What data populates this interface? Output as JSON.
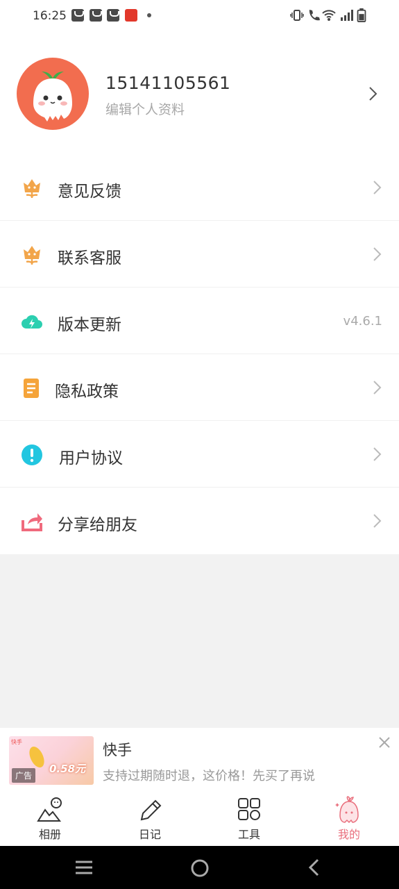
{
  "status_bar": {
    "time": "16:25"
  },
  "profile": {
    "phone": "15141105561",
    "subtitle": "编辑个人资料"
  },
  "menu": {
    "items": [
      {
        "label": "意见反馈",
        "icon": "flower-icon"
      },
      {
        "label": "联系客服",
        "icon": "flower-icon"
      },
      {
        "label": "版本更新",
        "icon": "cloud-upload-icon",
        "value": "v4.6.1"
      },
      {
        "label": "隐私政策",
        "icon": "document-icon"
      },
      {
        "label": "用户协议",
        "icon": "info-icon"
      },
      {
        "label": "分享给朋友",
        "icon": "share-icon"
      }
    ]
  },
  "ad": {
    "title": "快手",
    "description": "支持过期随时退，这价格！先买了再说",
    "tag": "广告",
    "price": "0.58元",
    "brand": "快手"
  },
  "tabs": [
    {
      "label": "相册",
      "icon": "album-icon"
    },
    {
      "label": "日记",
      "icon": "pencil-icon"
    },
    {
      "label": "工具",
      "icon": "grid-icon"
    },
    {
      "label": "我的",
      "icon": "mascot-icon",
      "active": true
    }
  ],
  "colors": {
    "accent": "#e96e7c",
    "avatar_bg": "#f26d4f",
    "flower": "#f2a54a",
    "cloud": "#2ccfb0",
    "document": "#f5a43a",
    "info": "#22c6e0",
    "share": "#f06a7d"
  }
}
